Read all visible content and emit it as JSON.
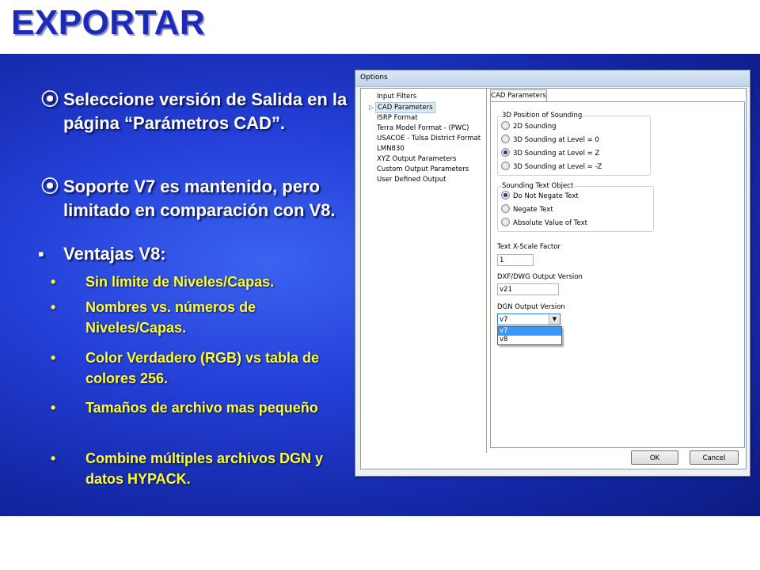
{
  "slide": {
    "title": "EXPORTAR",
    "bullets_level1": [
      {
        "marker": "⦿",
        "text": "Seleccione versión de Salida en la página “Parámetros CAD”."
      },
      {
        "marker": "⦿",
        "text": "Soporte V7 es mantenido, pero limitado en comparación con V8."
      }
    ],
    "bullet_level2": {
      "marker": "▪",
      "text": "Ventajas V8:"
    },
    "bullets_level3": [
      {
        "marker": "•",
        "text": "Sin límite de Niveles/Capas."
      },
      {
        "marker": "•",
        "text": "Nombres vs. números de Niveles/Capas."
      },
      {
        "marker": "•",
        "text": "Color Verdadero (RGB) vs tabla de colores 256."
      },
      {
        "marker": "•",
        "text": "Tamaños de archivo mas pequeño"
      },
      {
        "marker": "•",
        "text": "Combine múltiples archivos DGN y datos HYPACK."
      }
    ]
  },
  "dialog": {
    "title": "Options",
    "tree_items": [
      "Input Filters",
      "CAD Parameters",
      "ISRP Format",
      "Terra Model Format - (PWC)",
      "USACOE - Tulsa District Format",
      "LMN830",
      "XYZ Output Parameters",
      "Custom Output Parameters",
      "User Defined Output"
    ],
    "tab_label": "CAD Parameters",
    "position_group": {
      "label": "3D Position of Sounding",
      "options": [
        "2D Sounding",
        "3D Sounding at Level = 0",
        "3D Sounding at Level = Z",
        "3D Sounding at Level = -Z"
      ],
      "selected": 2
    },
    "sounding_text_group": {
      "label": "Sounding Text Object",
      "options": [
        "Do Not Negate Text",
        "Negate Text",
        "Absolute Value of Text"
      ],
      "selected": 0
    },
    "xscale": {
      "label": "Text X-Scale Factor",
      "value": "1"
    },
    "dxf_version": {
      "label": "DXF/DWG Output Version",
      "value": "v21"
    },
    "dgn_version": {
      "label": "DGN Output Version",
      "value": "v7",
      "options": [
        "v7",
        "v8"
      ],
      "highlighted": 0
    },
    "ok_label": "OK",
    "cancel_label": "Cancel"
  },
  "colors": {
    "title": "#1d2ab8",
    "background_blue": "#2440d8",
    "level1_text": "#ffffff",
    "level3_text": "#ffff33",
    "dropdown_highlight": "#3399ff"
  }
}
